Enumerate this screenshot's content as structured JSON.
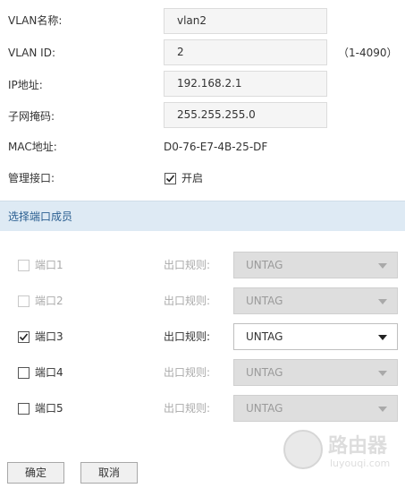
{
  "form": {
    "vlan_name": {
      "label": "VLAN名称:",
      "value": "vlan2"
    },
    "vlan_id": {
      "label": "VLAN ID:",
      "value": "2",
      "hint": "（1-4090）"
    },
    "ip": {
      "label": "IP地址:",
      "value": "192.168.2.1"
    },
    "mask": {
      "label": "子网掩码:",
      "value": "255.255.255.0"
    },
    "mac": {
      "label": "MAC地址:",
      "value": "D0-76-E7-4B-25-DF"
    },
    "mgmt": {
      "label": "管理接口:",
      "checkbox_label": "开启",
      "checked": true
    }
  },
  "section": {
    "title": "选择端口成员"
  },
  "ports": [
    {
      "label": "端口1",
      "checked": false,
      "disabled": true,
      "rule_label": "出口规则:",
      "rule_value": "UNTAG",
      "rule_enabled": false
    },
    {
      "label": "端口2",
      "checked": false,
      "disabled": true,
      "rule_label": "出口规则:",
      "rule_value": "UNTAG",
      "rule_enabled": false
    },
    {
      "label": "端口3",
      "checked": true,
      "disabled": false,
      "rule_label": "出口规则:",
      "rule_value": "UNTAG",
      "rule_enabled": true
    },
    {
      "label": "端口4",
      "checked": false,
      "disabled": false,
      "rule_label": "出口规则:",
      "rule_value": "UNTAG",
      "rule_enabled": false
    },
    {
      "label": "端口5",
      "checked": false,
      "disabled": false,
      "rule_label": "出口规则:",
      "rule_value": "UNTAG",
      "rule_enabled": false
    }
  ],
  "buttons": {
    "ok": "确定",
    "cancel": "取消"
  },
  "watermark": {
    "title": "路由器",
    "subtitle": "luyouqi.com"
  },
  "colors": {
    "section_bg": "#deeaf4",
    "section_text": "#2b5f91",
    "field_bg": "#f5f5f5",
    "select_disabled_bg": "#dedede"
  }
}
